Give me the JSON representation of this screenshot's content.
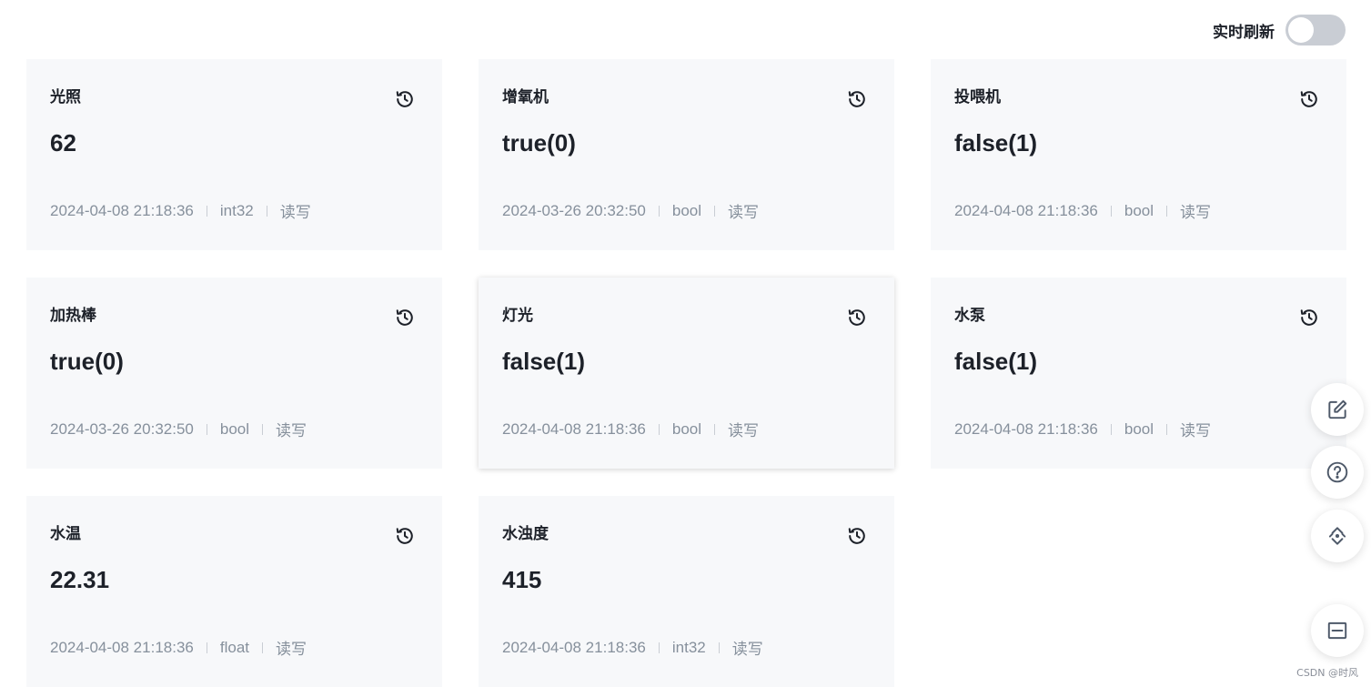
{
  "header": {
    "realtime_label": "实时刷新",
    "realtime_enabled": false
  },
  "cards": [
    {
      "title": "光照",
      "value": "62",
      "time": "2024-04-08 21:18:36",
      "type": "int32",
      "access": "读写"
    },
    {
      "title": "增氧机",
      "value": "true(0)",
      "time": "2024-03-26 20:32:50",
      "type": "bool",
      "access": "读写"
    },
    {
      "title": "投喂机",
      "value": "false(1)",
      "time": "2024-04-08 21:18:36",
      "type": "bool",
      "access": "读写"
    },
    {
      "title": "加热棒",
      "value": "true(0)",
      "time": "2024-03-26 20:32:50",
      "type": "bool",
      "access": "读写"
    },
    {
      "title": "灯光",
      "value": "false(1)",
      "time": "2024-04-08 21:18:36",
      "type": "bool",
      "access": "读写"
    },
    {
      "title": "水泵",
      "value": "false(1)",
      "time": "2024-04-08 21:18:36",
      "type": "bool",
      "access": "读写"
    },
    {
      "title": "水温",
      "value": "22.31",
      "time": "2024-04-08 21:18:36",
      "type": "float",
      "access": "读写"
    },
    {
      "title": "水浊度",
      "value": "415",
      "time": "2024-04-08 21:18:36",
      "type": "int32",
      "access": "读写"
    }
  ],
  "icons": {
    "history": "history-icon",
    "edit": "edit-icon",
    "help": "help-icon",
    "sync": "sync-icon",
    "collapse": "collapse-icon"
  },
  "watermark": "CSDN @时风"
}
